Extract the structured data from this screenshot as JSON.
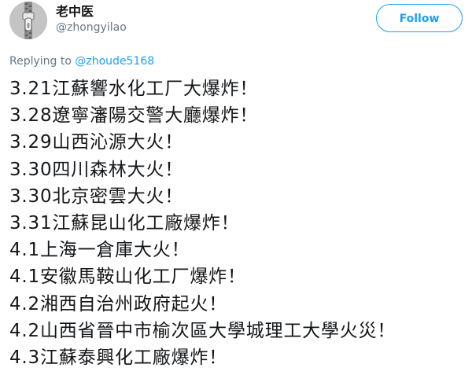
{
  "tweet": {
    "author": {
      "display_name": "老中医",
      "handle": "@zhongyilao",
      "avatar_icon": "zipper-avatar-icon"
    },
    "follow_button_label": "Follow",
    "replying_to_label": "Replying to",
    "replying_to_handle": "@zhoude5168",
    "lines": [
      "3.21江蘇響水化工厂大爆炸！",
      "3.28遼寧瀋陽交警大廳爆炸！",
      "3.29山西沁源大火！",
      "3.30四川森林大火！",
      "3.30北京密雲大火！",
      "3.31江蘇昆山化工廠爆炸！",
      "4.1上海一倉庫大火！",
      "4.1安徽馬鞍山化工厂爆炸！",
      "4.2湘西自治州政府起火！",
      "4.2山西省晉中市榆次區大學城理工大學火災！",
      "4.3江蘇泰興化工廠爆炸！"
    ]
  },
  "colors": {
    "accent": "#1da1f2",
    "text_primary": "#14171a",
    "text_secondary": "#657786"
  }
}
